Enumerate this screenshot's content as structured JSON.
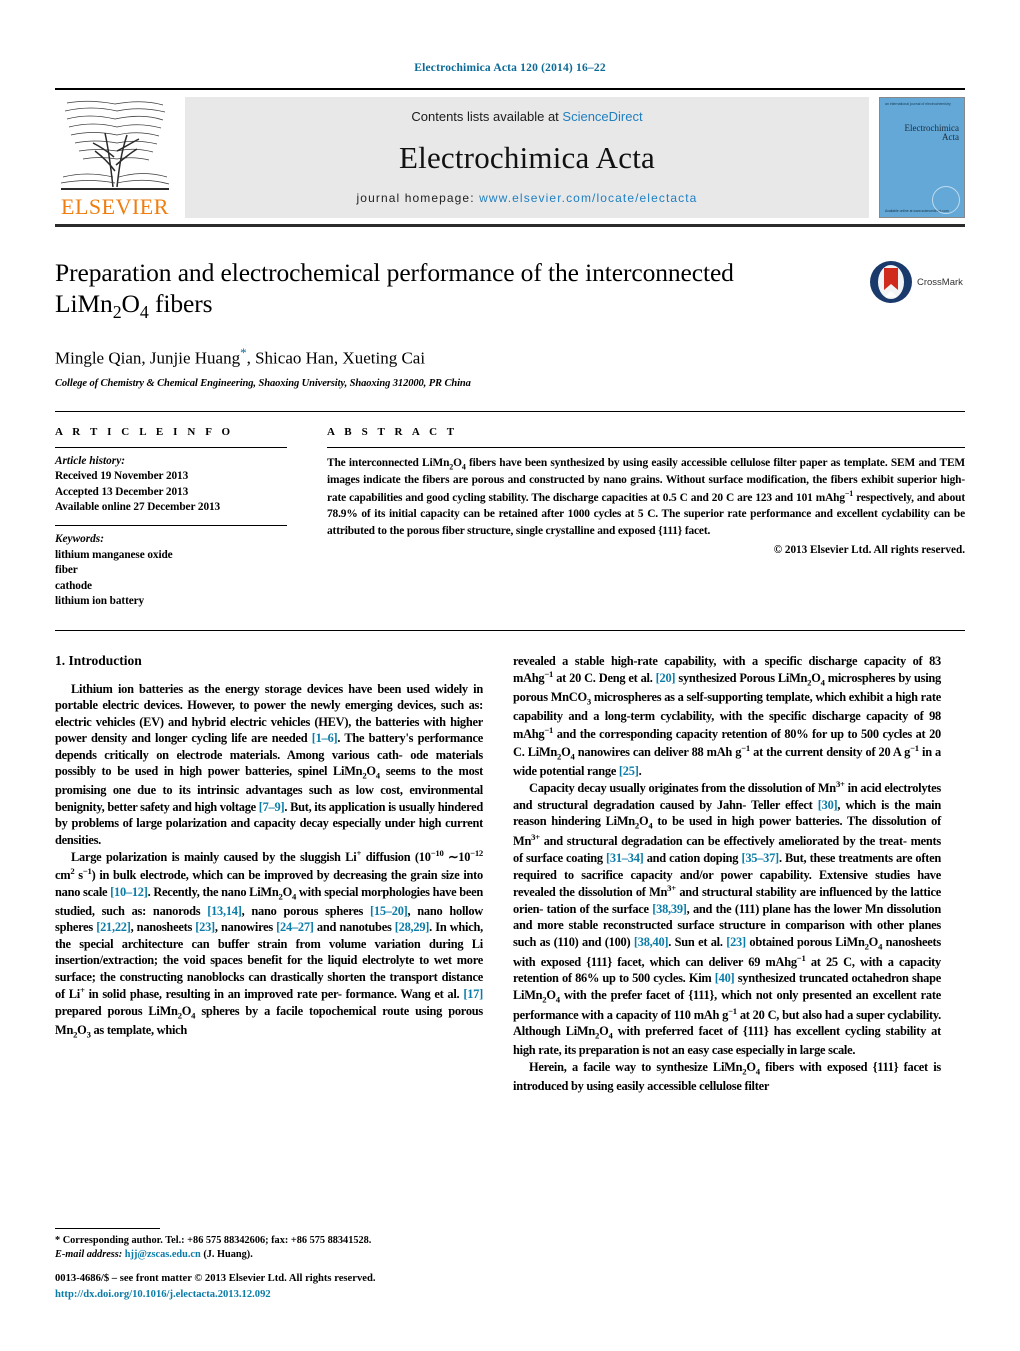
{
  "running_head": "Electrochimica Acta 120 (2014) 16–22",
  "masthead": {
    "contents_prefix": "Contents lists available at ",
    "sciencedirect": "ScienceDirect",
    "journal_name": "Electrochimica Acta",
    "homepage_prefix": "journal homepage: ",
    "homepage_url": "www.elsevier.com/locate/electacta",
    "publisher": "ELSEVIER",
    "cover": {
      "title_line1": "Electrochimica",
      "title_line2": "Acta",
      "tiny_top": "an international journal of electrochemistry",
      "tiny_bottom": "Available online at\nwww.sciencedirect.com"
    }
  },
  "article": {
    "title": "Preparation and electrochemical performance of the interconnected LiMn2O4 fibers",
    "title_parts": {
      "line1": "Preparation and electrochemical performance of the interconnected",
      "line2_pre": "LiMn",
      "line2_sub1": "2",
      "line2_mid": "O",
      "line2_sub2": "4",
      "line2_post": " fibers"
    },
    "authors": "Mingle Qian, Junjie Huang",
    "authors_tail": ", Shicao Han, Xueting Cai",
    "corresponding_marker": "*",
    "affiliation": "College of Chemistry & Chemical Engineering, Shaoxing University, Shaoxing 312000, PR China",
    "crossmark_label": "CrossMark"
  },
  "article_info": {
    "heading": "A R T I C L E   I N F O",
    "history_label": "Article history:",
    "history": [
      "Received 19 November 2013",
      "Accepted 13 December 2013",
      "Available online 27 December 2013"
    ],
    "keywords_label": "Keywords:",
    "keywords": [
      "lithium manganese oxide",
      "fiber",
      "cathode",
      "lithium ion battery"
    ]
  },
  "abstract": {
    "heading": "A B S T R A C T",
    "paragraph_1": "The interconnected LiMn",
    "text_full": "The interconnected LiMn2O4 fibers have been synthesized by using easily accessible cellulose filter paper as template. SEM and TEM images indicate the fibers are porous and constructed by nano grains. Without surface modification, the fibers exhibit superior high-rate capabilities and good cycling stability. The discharge capacities at 0.5 C and 20 C are 123 and 101 mAhg−1 respectively, and about 78.9% of its initial capacity can be retained after 1000 cycles at 5 C. The superior rate performance and excellent cyclability can be attributed to the porous fiber structure, single crystalline and exposed {111} facet.",
    "copyright": "© 2013 Elsevier Ltd. All rights reserved."
  },
  "sections": {
    "introduction_heading": "1.  Introduction"
  },
  "body": {
    "left_para_1": "Lithium ion batteries as the energy storage devices have been used widely in portable electric devices. However, to power the newly emerging devices, such as: electric vehicles (EV) and hybrid electric vehicles (HEV), the batteries with higher power density and longer cycling life are needed [1–6]. The battery's performance depends critically on electrode materials. Among various cathode materials possibly to be used in high power batteries, spinel LiMn2O4 seems to the most promising one due to its intrinsic advantages such as low cost, environmental benignity, better safety and high voltage [7–9]. But, its application is usually hindered by problems of large polarization and capacity decay especially under high current densities.",
    "left_para_2": "Large polarization is mainly caused by the sluggish Li+ diffusion (10−10 ∼10−12 cm2 s−1) in bulk electrode, which can be improved by decreasing the grain size into nano scale [10–12]. Recently, the nano LiMn2O4 with special morphologies have been studied, such as: nanorods [13,14], nano porous spheres [15–20], nano hollow spheres [21,22], nanosheets [23], nanowires [24–27] and nanotubes [28,29]. In which, the special architecture can buffer strain from volume variation during Li insertion/extraction; the void spaces benefit for the liquid electrolyte to wet more surface; the constructing nanoblocks can drastically shorten the transport distance of Li+ in solid phase, resulting in an improved rate performance. Wang et al. [17] prepared porous LiMn2O4 spheres by a facile topochemical route using porous Mn2O3 as template, which",
    "right_para_1": "revealed a stable high-rate capability, with a specific discharge capacity of 83 mAhg−1 at 20 C. Deng et al. [20] synthesized Porous LiMn2O4 microspheres by using porous MnCO3 microspheres as a self-supporting template, which exhibit a high rate capability and a long-term cyclability, with the specific discharge capacity of 98 mAhg−1 and the corresponding capacity retention of 80% for up to 500 cycles at 20 C. LiMn2O4 nanowires can deliver 88 mAh g−1 at the current density of 20 A g−1 in a wide potential range [25].",
    "right_para_2": "Capacity decay usually originates from the dissolution of Mn3+ in acid electrolytes and structural degradation caused by Jahn-Teller effect [30], which is the main reason hindering LiMn2O4 to be used in high power batteries. The dissolution of Mn3+ and structural degradation can be effectively ameliorated by the treatments of surface coating [31–34] and cation doping [35–37]. But, these treatments are often required to sacrifice capacity and/or power capability. Extensive studies have revealed the dissolution of Mn3+ and structural stability are influenced by the lattice orientation of the surface [38,39], and the (111) plane has the lower Mn dissolution and more stable reconstructed surface structure in comparison with other planes such as (110) and (100) [38,40]. Sun et al. [23] obtained porous LiMn2O4 nanosheets with exposed {111} facet, which can deliver 69 mAhg−1 at 25 C, with a capacity retention of 86% up to 500 cycles. Kim [40] synthesized truncated octahedron shape LiMn2O4 with the prefer facet of {111}, which not only presented an excellent rate performance with a capacity of 110 mAh g−1 at 20 C, but also had a super cyclability. Although LiMn2O4 with preferred facet of {111} has excellent cycling stability at high rate, its preparation is not an easy case especially in large scale.",
    "right_para_3": "Herein, a facile way to synthesize LiMn2O4 fibers with exposed {111} facet is introduced by using easily accessible cellulose filter"
  },
  "footnote": {
    "corresponding": "* Corresponding author. Tel.: +86 575 88342606; fax: +86 575 88341528.",
    "email_label": "E-mail address:",
    "email": "hjj@zscas.edu.cn",
    "email_tail": "(J. Huang)."
  },
  "footer": {
    "issn_line": "0013-4686/$ – see front matter © 2013 Elsevier Ltd. All rights reserved.",
    "doi": "http://dx.doi.org/10.1016/j.electacta.2013.12.092"
  },
  "colors": {
    "link": "#0b7ca8",
    "runhead": "#0b6a96",
    "elsevier_orange": "#ef7d10",
    "cover_blue": "#64a8d8",
    "band_gray": "#e8e8e8"
  }
}
